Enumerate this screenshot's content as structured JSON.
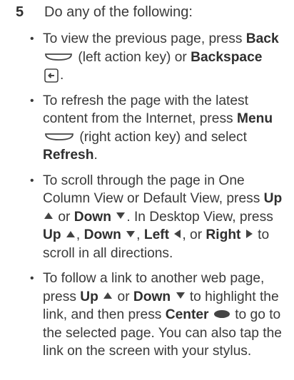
{
  "step": {
    "number": "5",
    "instruction": "Do any of the following:"
  },
  "bullets": [
    {
      "parts": {
        "t1": "To view the previous page, press ",
        "b1": "Back",
        "t2": " (left action key) or ",
        "b2": "Backspace",
        "t3": "."
      }
    },
    {
      "parts": {
        "t1": "To refresh the page with the latest content from the Internet, press ",
        "b1": "Menu",
        "t2": " (right action key) and select ",
        "b2": "Refresh",
        "t3": "."
      }
    },
    {
      "parts": {
        "t1": "To scroll through the page in One Column View or Default View, press ",
        "b1": "Up",
        "t2": " or ",
        "b2": "Down",
        "t3": ". In Desktop View, press ",
        "b3": "Up",
        "t4": ", ",
        "b4": "Down",
        "t5": ", ",
        "b5": "Left",
        "t6": ", or ",
        "b6": "Right",
        "t7": " to scroll in all directions."
      }
    },
    {
      "parts": {
        "t1": "To follow a link to another web page, press ",
        "b1": "Up",
        "t2": " or ",
        "b2": "Down",
        "t3": " to highlight the link, and then press ",
        "b3": "Center",
        "t4": " to go to the selected page. You can also tap the link on the screen with your stylus."
      }
    }
  ],
  "bullet_glyph": "•",
  "icons": {
    "left_action_key": "left-action-key-icon",
    "backspace_key": "backspace-key-icon",
    "right_action_key": "right-action-key-icon",
    "up_arrow": "up-arrow-icon",
    "down_arrow": "down-arrow-icon",
    "left_arrow": "left-arrow-icon",
    "right_arrow": "right-arrow-icon",
    "center_key": "center-key-icon"
  },
  "colors": {
    "text": "#3a3a3a",
    "icon": "#444444"
  }
}
